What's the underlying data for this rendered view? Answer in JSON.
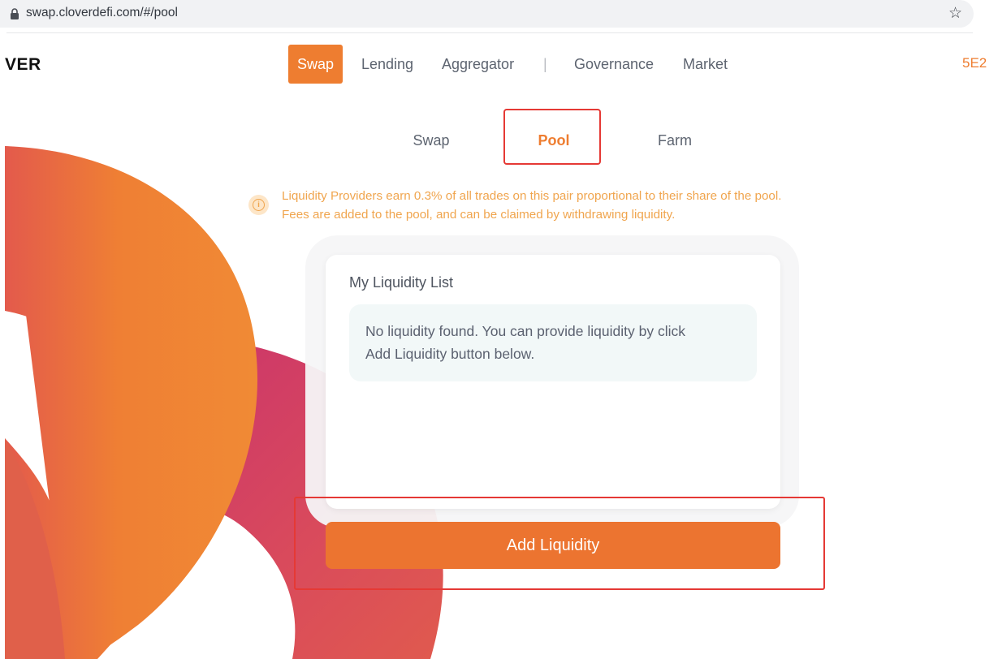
{
  "browser": {
    "url": "swap.cloverdefi.com/#/pool",
    "lock_icon": "lock-icon",
    "bookmark_icon": "star-icon"
  },
  "header": {
    "logo": "VER",
    "nav": {
      "swap": "Swap",
      "lending": "Lending",
      "aggregator": "Aggregator",
      "separator": "|",
      "governance": "Governance",
      "market": "Market"
    },
    "wallet": "5E2"
  },
  "tabs": {
    "swap": "Swap",
    "pool": "Pool",
    "farm": "Farm",
    "active": "Pool"
  },
  "notice": {
    "icon": "info-icon",
    "line1": "Liquidity Providers earn 0.3% of all trades on this pair proportional to their share of the pool.",
    "line2": "Fees are added to the pool, and can be claimed by withdrawing liquidity."
  },
  "liquidity": {
    "title": "My Liquidity List",
    "empty_line1": "No liquidity found. You can provide liquidity by click",
    "empty_line2": "Add Liquidity button below."
  },
  "actions": {
    "add_liquidity": "Add Liquidity"
  },
  "colors": {
    "accent": "#ee7d30",
    "notice": "#f0a54e",
    "highlight": "#e53935"
  }
}
